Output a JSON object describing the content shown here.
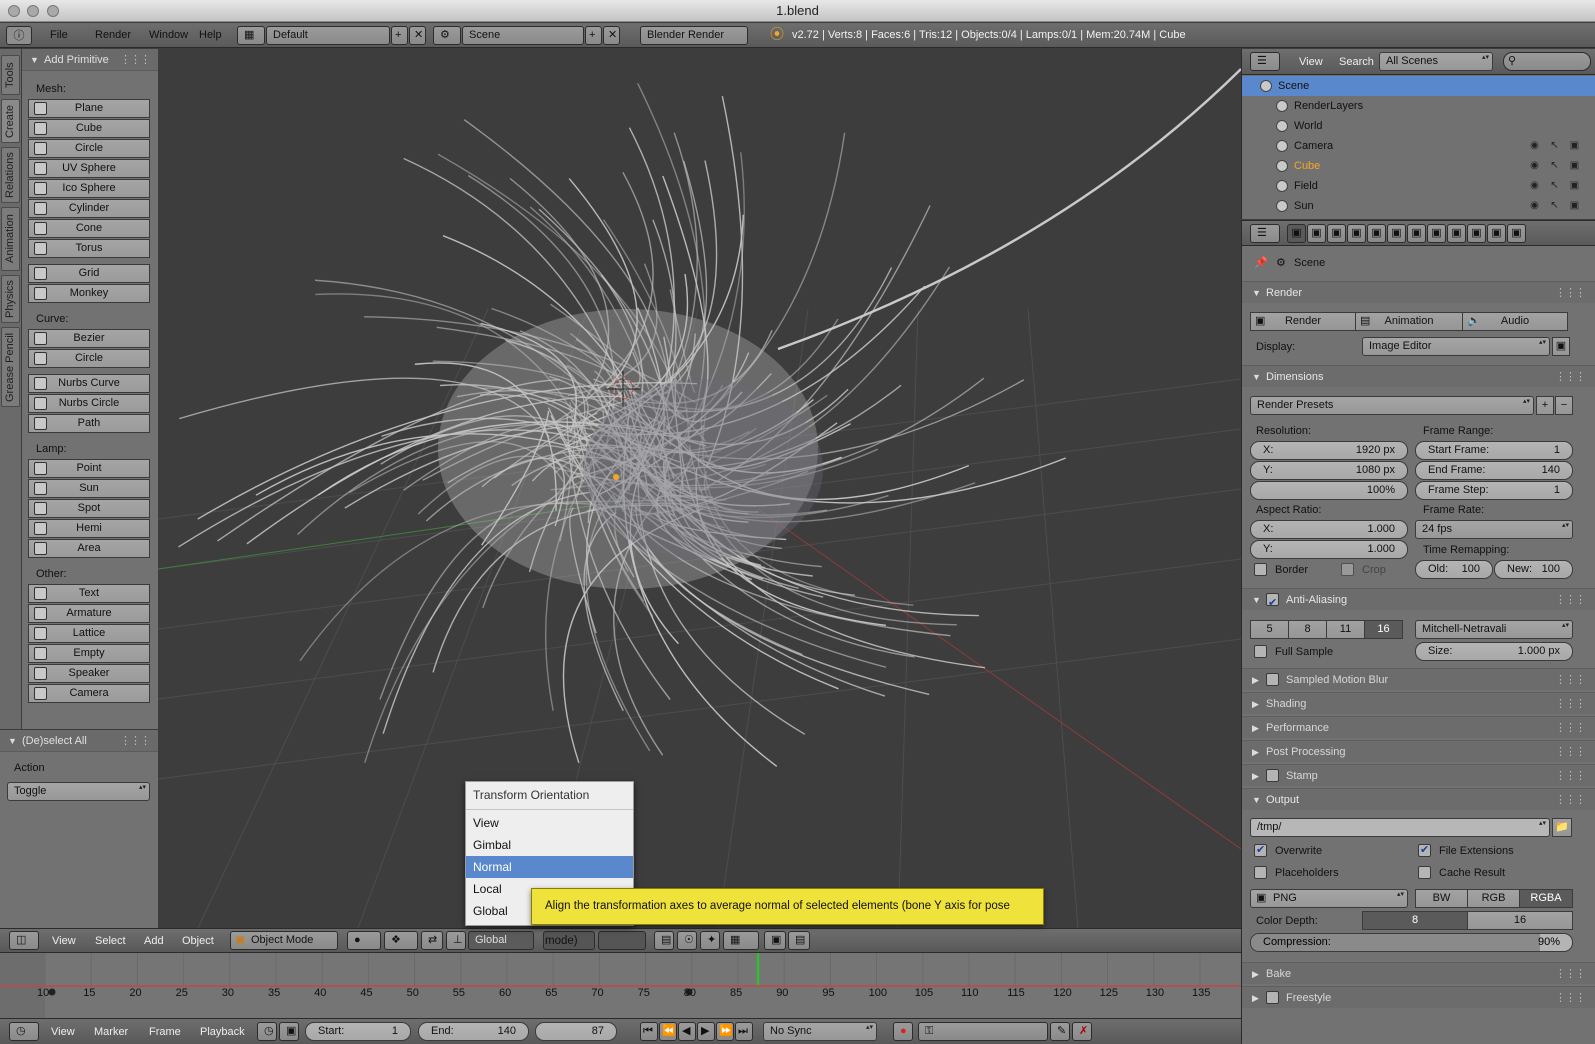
{
  "window": {
    "title": "1.blend"
  },
  "info_header": {
    "menus": [
      "File",
      "Render",
      "Window",
      "Help"
    ],
    "screen_layout": "Default",
    "scene": "Scene",
    "engine": "Blender Render",
    "stats": "v2.72 | Verts:8 | Faces:6 | Tris:12 | Objects:0/4 | Lamps:0/1 | Mem:20.74M | Cube"
  },
  "tool_tabs": [
    "Tools",
    "Create",
    "Relations",
    "Animation",
    "Physics",
    "Grease Pencil"
  ],
  "add_primitive": {
    "title": "Add Primitive",
    "groups": [
      {
        "label": "Mesh:",
        "items": [
          "Plane",
          "Cube",
          "Circle",
          "UV Sphere",
          "Ico Sphere",
          "Cylinder",
          "Cone",
          "Torus"
        ]
      },
      {
        "label": "",
        "items": [
          "Grid",
          "Monkey"
        ]
      },
      {
        "label": "Curve:",
        "items": [
          "Bezier",
          "Circle"
        ]
      },
      {
        "label": "",
        "items": [
          "Nurbs Curve",
          "Nurbs Circle",
          "Path"
        ]
      },
      {
        "label": "Lamp:",
        "items": [
          "Point",
          "Sun",
          "Spot",
          "Hemi",
          "Area"
        ]
      },
      {
        "label": "Other:",
        "items": [
          "Text",
          "Armature",
          "Lattice",
          "Empty",
          "Speaker",
          "Camera"
        ]
      }
    ]
  },
  "redo_panel": {
    "title": "(De)select All",
    "action_label": "Action",
    "action_value": "Toggle"
  },
  "view3d_header": {
    "menus": [
      "View",
      "Select",
      "Add",
      "Object"
    ],
    "mode": "Object Mode",
    "orientation": "Global"
  },
  "orientation_menu": {
    "title": "Transform Orientation",
    "items": [
      "View",
      "Gimbal",
      "Normal",
      "Local",
      "Global"
    ],
    "highlighted": "Normal",
    "tooltip": "Align the transformation axes to average normal of selected elements (bone Y axis for pose mode)"
  },
  "timeline": {
    "ticks": [
      "10",
      "15",
      "20",
      "25",
      "30",
      "35",
      "40",
      "45",
      "50",
      "55",
      "60",
      "65",
      "70",
      "75",
      "80",
      "85",
      "90",
      "95",
      "100",
      "105",
      "110",
      "115",
      "120",
      "125",
      "130",
      "135"
    ],
    "menus": [
      "View",
      "Marker",
      "Frame",
      "Playback"
    ],
    "start_label": "Start:",
    "start": "1",
    "end_label": "End:",
    "end": "140",
    "current": "87",
    "sync": "No Sync"
  },
  "outliner": {
    "menus": [
      "View",
      "Search"
    ],
    "filter": "All Scenes",
    "items": [
      "Scene",
      "RenderLayers",
      "World",
      "Camera",
      "Cube",
      "Field",
      "Sun"
    ],
    "active_item": "Cube"
  },
  "properties": {
    "context": "Scene",
    "render": {
      "title": "Render",
      "buttons": [
        "Render",
        "Animation",
        "Audio"
      ],
      "display_label": "Display:",
      "display": "Image Editor"
    },
    "dimensions": {
      "title": "Dimensions",
      "presets": "Render Presets",
      "resolution_label": "Resolution:",
      "res_x_label": "X:",
      "res_x": "1920 px",
      "res_y_label": "Y:",
      "res_y": "1080 px",
      "res_pct": "100%",
      "frame_range_label": "Frame Range:",
      "start_label": "Start Frame:",
      "start": "1",
      "end_label": "End Frame:",
      "end": "140",
      "step_label": "Frame Step:",
      "step": "1",
      "aspect_label": "Aspect Ratio:",
      "asp_x_label": "X:",
      "asp_x": "1.000",
      "asp_y_label": "Y:",
      "asp_y": "1.000",
      "frame_rate_label": "Frame Rate:",
      "fps": "24 fps",
      "remap_label": "Time Remapping:",
      "old_label": "Old:",
      "old": "100",
      "new_label": "New:",
      "new": "100",
      "border": "Border",
      "crop": "Crop"
    },
    "anti_aliasing": {
      "title": "Anti-Aliasing",
      "samples": [
        "5",
        "8",
        "11",
        "16"
      ],
      "active_sample": "16",
      "filter": "Mitchell-Netravali",
      "full_sample": "Full Sample",
      "size_label": "Size:",
      "size": "1.000 px"
    },
    "collapsed": [
      "Sampled Motion Blur",
      "Shading",
      "Performance",
      "Post Processing",
      "Stamp"
    ],
    "output": {
      "title": "Output",
      "path": "/tmp/",
      "overwrite": "Overwrite",
      "file_extensions": "File Extensions",
      "placeholders": "Placeholders",
      "cache_result": "Cache Result",
      "format": "PNG",
      "color_modes": [
        "BW",
        "RGB",
        "RGBA"
      ],
      "active_color_mode": "RGBA",
      "depth_label": "Color Depth:",
      "depths": [
        "8",
        "16"
      ],
      "compression_label": "Compression:",
      "compression": "90%"
    },
    "bottom": [
      "Bake",
      "Freestyle"
    ]
  },
  "colors": {
    "accent": "#5680c2",
    "highlight_menu": "#5a88cc",
    "tooltip": "#efe23a",
    "active_object": "#f5a623",
    "playhead": "#2fbf2f"
  }
}
